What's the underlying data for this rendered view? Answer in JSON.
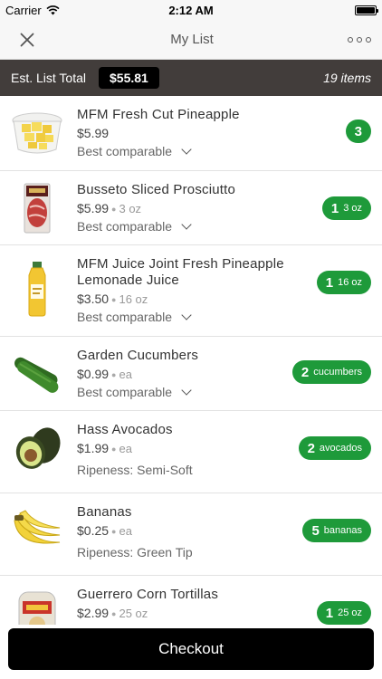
{
  "status_bar": {
    "carrier": "Carrier",
    "time": "2:12 AM"
  },
  "nav": {
    "title": "My List"
  },
  "summary": {
    "label": "Est. List Total",
    "total": "$55.81",
    "count": "19 items"
  },
  "items": [
    {
      "name": "MFM Fresh Cut Pineapple",
      "price": "$5.99",
      "unit": "",
      "option": "Best comparable",
      "qty": "3",
      "qty_unit": ""
    },
    {
      "name": "Busseto Sliced Prosciutto",
      "price": "$5.99",
      "unit": "3 oz",
      "option": "Best comparable",
      "qty": "1",
      "qty_unit": "3 oz"
    },
    {
      "name": "MFM Juice Joint Fresh Pineapple Lemonade Juice",
      "price": "$3.50",
      "unit": "16 oz",
      "option": "Best comparable",
      "qty": "1",
      "qty_unit": "16 oz"
    },
    {
      "name": "Garden Cucumbers",
      "price": "$0.99",
      "unit": "ea",
      "option": "Best comparable",
      "qty": "2",
      "qty_unit": "cucumbers"
    },
    {
      "name": "Hass Avocados",
      "price": "$1.99",
      "unit": "ea",
      "option": "Ripeness: Semi-Soft",
      "qty": "2",
      "qty_unit": "avocados"
    },
    {
      "name": "Bananas",
      "price": "$0.25",
      "unit": "ea",
      "option": "Ripeness: Green Tip",
      "qty": "5",
      "qty_unit": "bananas"
    },
    {
      "name": "Guerrero Corn Tortillas",
      "price": "$2.99",
      "unit": "25 oz",
      "option": "",
      "qty": "1",
      "qty_unit": "25 oz"
    }
  ],
  "checkout": {
    "label": "Checkout"
  },
  "colors": {
    "accent": "#1e9a3a",
    "summary_bg": "#423d3b"
  }
}
